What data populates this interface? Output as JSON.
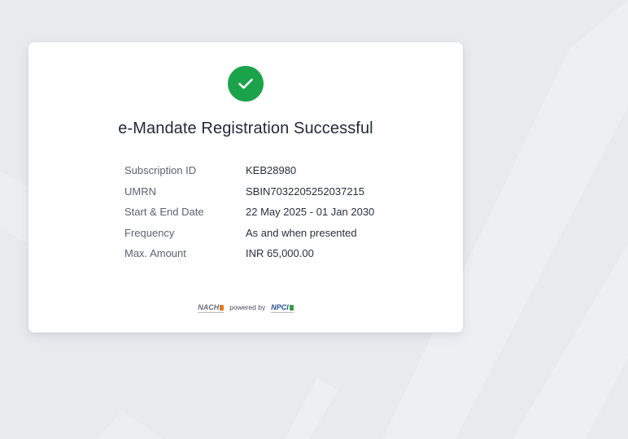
{
  "status_icon": "check-icon",
  "title": "e-Mandate Registration Successful",
  "details": [
    {
      "label": "Subscription ID",
      "value": "KEB28980"
    },
    {
      "label": "UMRN",
      "value": "SBIN7032205252037215"
    },
    {
      "label": "Start & End Date",
      "value": "22 May 2025 - 01 Jan 2030"
    },
    {
      "label": "Frequency",
      "value": "As and when presented"
    },
    {
      "label": "Max. Amount",
      "value": "INR 65,000.00"
    }
  ],
  "footer": {
    "logo_left": "NACH",
    "powered_by": "powered by",
    "logo_right": "NPCI"
  },
  "colors": {
    "success": "#1aa34a",
    "background": "#e8eaee",
    "card": "#ffffff",
    "title_text": "#242a3a"
  }
}
